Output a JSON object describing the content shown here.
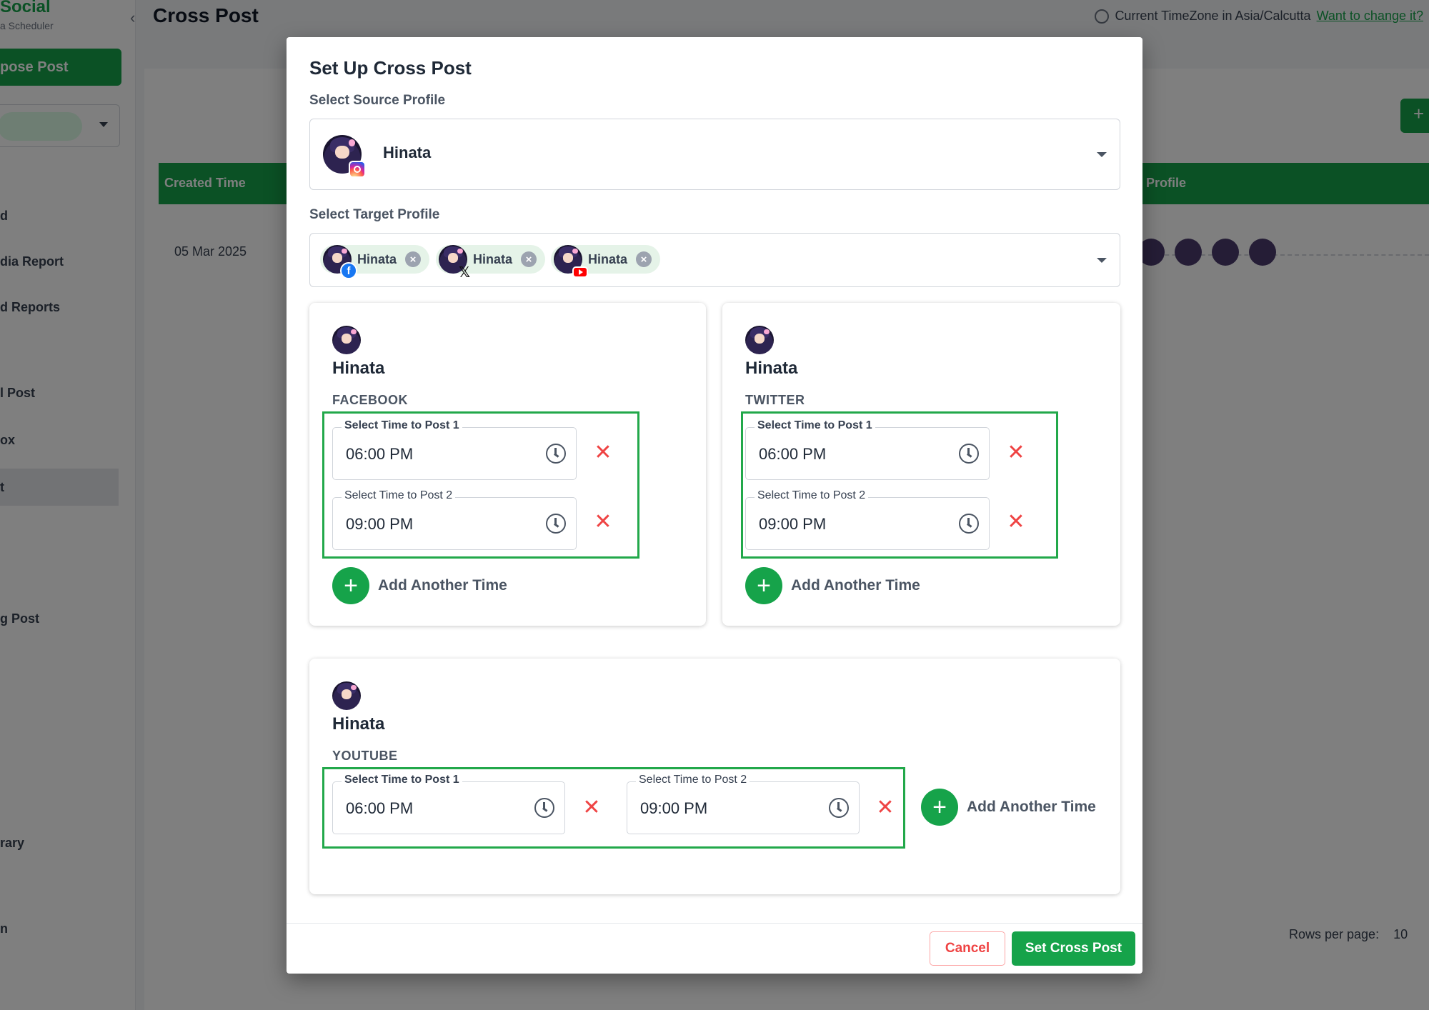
{
  "app": {
    "brand": "Social",
    "brand_sub": "a Scheduler",
    "compose_label": "pose Post",
    "page_title": "Cross Post",
    "timezone_text": "Current TimeZone in Asia/Calcutta",
    "timezone_link": "Want to change it?",
    "sidebar_items": [
      "d",
      "dia Report",
      "d Reports",
      "l Post",
      "ox",
      "t",
      "g Post",
      "rary",
      "n"
    ],
    "table": {
      "col_created": "Created Time",
      "col_profile": "Profile",
      "row_date": "05 Mar 2025"
    },
    "rows_per_page_label": "Rows per page:",
    "rows_per_page_value": "10"
  },
  "modal": {
    "title": "Set Up Cross Post",
    "source_label": "Select Source Profile",
    "source_profile": {
      "name": "Hinata",
      "platform_icon": "instagram-icon"
    },
    "target_label": "Select Target Profile",
    "target_chips": [
      {
        "name": "Hinata",
        "platform_icon": "facebook-icon"
      },
      {
        "name": "Hinata",
        "platform_icon": "x-icon"
      },
      {
        "name": "Hinata",
        "platform_icon": "youtube-icon"
      }
    ],
    "cards": [
      {
        "name": "Hinata",
        "platform": "FACEBOOK",
        "times": [
          {
            "label": "Select Time to Post 1",
            "value": "06:00 PM"
          },
          {
            "label": "Select Time to Post 2",
            "value": "09:00 PM"
          }
        ],
        "add_label": "Add Another Time"
      },
      {
        "name": "Hinata",
        "platform": "TWITTER",
        "times": [
          {
            "label": "Select Time to Post 1",
            "value": "06:00 PM"
          },
          {
            "label": "Select Time to Post 2",
            "value": "09:00 PM"
          }
        ],
        "add_label": "Add Another Time"
      },
      {
        "name": "Hinata",
        "platform": "YOUTUBE",
        "times": [
          {
            "label": "Select Time to Post 1",
            "value": "06:00 PM"
          },
          {
            "label": "Select Time to Post 2",
            "value": "09:00 PM"
          }
        ],
        "add_label": "Add Another Time"
      }
    ],
    "cancel_label": "Cancel",
    "submit_label": "Set Cross Post"
  },
  "colors": {
    "accent": "#16a34a",
    "highlight_frame": "#22a84a",
    "danger": "#ef4444"
  }
}
